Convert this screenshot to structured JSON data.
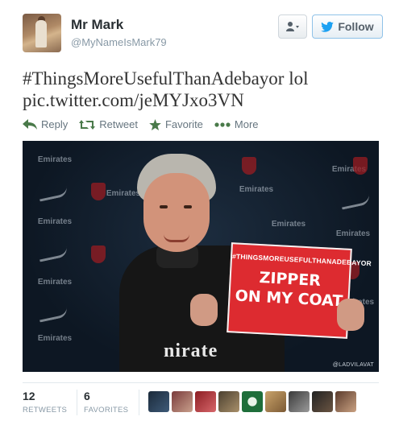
{
  "header": {
    "fullname": "Mr Mark",
    "username": "@MyNameIsMark79",
    "follow_label": "Follow",
    "user_dropdown_icon": "user-dropdown-icon"
  },
  "tweet": {
    "line1": "#ThingsMoreUsefulThanAdebayor lol",
    "line2": "pic.twitter.com/jeMYJxo3VN"
  },
  "actions": {
    "reply": "Reply",
    "retweet": "Retweet",
    "favorite": "Favorite",
    "more": "More"
  },
  "media": {
    "sign_hashtag": "#THINGSMOREUSEFULTHANADEBAYOR",
    "sign_line1": "ZIPPER",
    "sign_line2": "ON MY COAT",
    "chest_text": "nirate",
    "watermark": "@LADVILAVAT",
    "sponsor_tiles": [
      "Emirates",
      "Emirates",
      "Emirates",
      "Emirates",
      "Emirates",
      "Emirates",
      "Emirates",
      "Emirates",
      "Emirates",
      "Emirates"
    ]
  },
  "stats": {
    "retweets_count": "12",
    "retweets_label": "RETWEETS",
    "favorites_count": "6",
    "favorites_label": "FAVORITES"
  },
  "colors": {
    "link_blue": "#1da1f2",
    "sign_red": "#dd2b30",
    "muted": "#8899a6"
  }
}
